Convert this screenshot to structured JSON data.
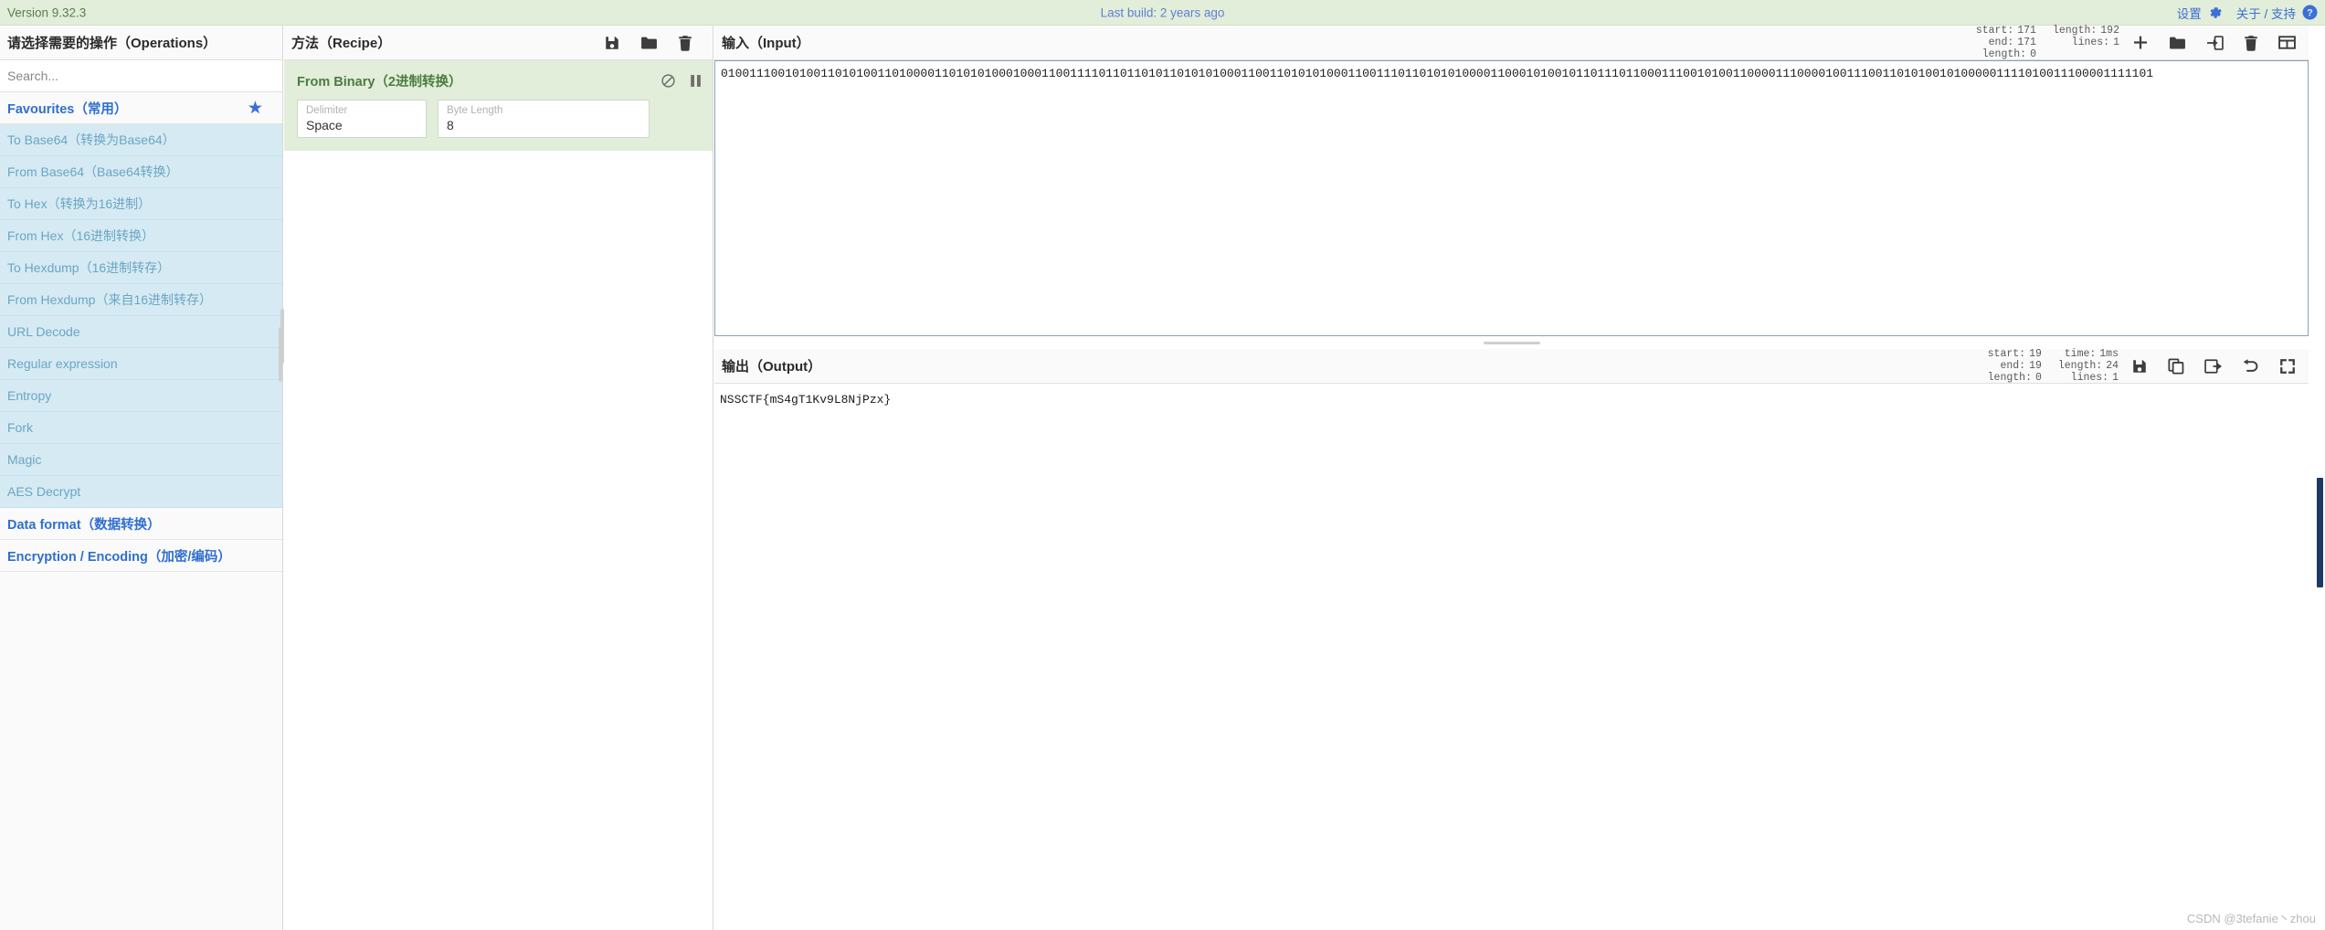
{
  "banner": {
    "version": "Version 9.32.3",
    "last_build": "Last build: 2 years ago",
    "settings_label": "设置",
    "about_label": "关于 / 支持",
    "accent_color": "#3c6fd8",
    "background_color": "#e2eed9"
  },
  "operations": {
    "title": "请选择需要的操作（Operations）",
    "search_placeholder": "Search...",
    "categories": [
      {
        "label": "Favourites（常用）",
        "starred": true,
        "items": [
          "To Base64（转换为Base64）",
          "From Base64（Base64转换）",
          "To Hex（转换为16进制）",
          "From Hex（16进制转换）",
          "To Hexdump（16进制转存）",
          "From Hexdump（来自16进制转存）",
          "URL Decode",
          "Regular expression",
          "Entropy",
          "Fork",
          "Magic",
          "AES Decrypt"
        ]
      },
      {
        "label": "Data format（数据转换）",
        "starred": false,
        "items": []
      },
      {
        "label": "Encryption / Encoding（加密/编码）",
        "starred": false,
        "items": []
      }
    ]
  },
  "recipe": {
    "title": "方法（Recipe）",
    "icons": [
      "save-icon",
      "folder-icon",
      "trash-icon"
    ],
    "operation": {
      "name": "From Binary（2进制转换）",
      "disable_icon": "disable-icon",
      "pause_icon": "pause-icon",
      "args": [
        {
          "label": "Delimiter",
          "value": "Space"
        },
        {
          "label": "Byte Length",
          "value": "8"
        }
      ]
    }
  },
  "input": {
    "title": "输入（Input）",
    "counters": {
      "start_label": "start:",
      "start_value": "171",
      "end_label": "end:",
      "end_value": "171",
      "sel_length_label": "length:",
      "sel_length_value": "0",
      "length_label": "length:",
      "length_value": "192",
      "lines_label": "lines:",
      "lines_value": "1"
    },
    "icons": [
      "add-tab-icon",
      "open-folder-icon",
      "open-file-icon",
      "clear-icon",
      "reset-layout-icon"
    ],
    "value": "010011100101001101010011010000110101010001000110011110110110101101010100011001101010100011001110110101010000110001010010110111011000111001010011000011100001001110011010100101000001111010011100001111101"
  },
  "output": {
    "title": "输出（Output）",
    "counters": {
      "start_label": "start:",
      "start_value": "19",
      "end_label": "end:",
      "end_value": "19",
      "sel_length_label": "length:",
      "sel_length_value": "0",
      "time_label": "time:",
      "time_value": "1ms",
      "length_label": "length:",
      "length_value": "24",
      "lines_label": "lines:",
      "lines_value": "1"
    },
    "icons": [
      "save-icon",
      "copy-icon",
      "replace-input-icon",
      "undo-icon",
      "maximise-icon"
    ],
    "value": "NSSCTF{mS4gT1Kv9L8NjPzx}"
  },
  "watermark": "CSDN @3tefanie丶zhou"
}
